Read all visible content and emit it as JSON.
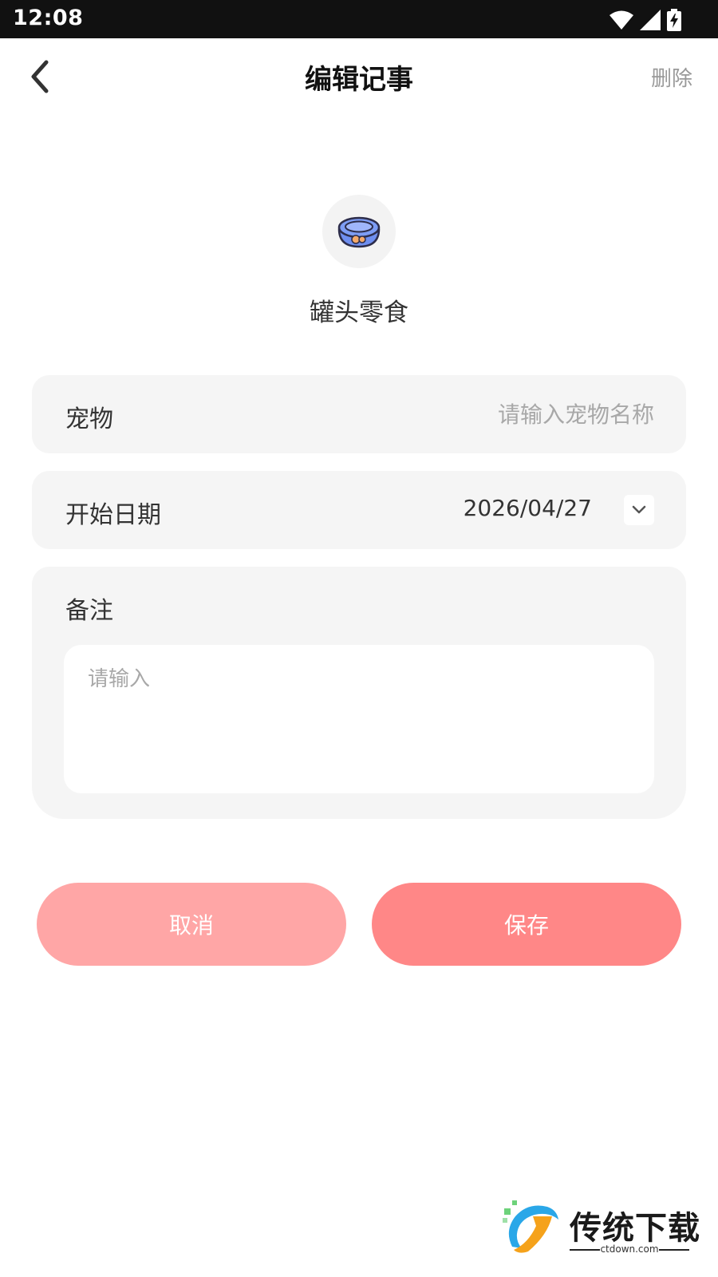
{
  "status_bar": {
    "time": "12:08",
    "icons": [
      "wifi-icon",
      "signal-icon",
      "battery-charging-icon"
    ]
  },
  "nav": {
    "title": "编辑记事",
    "delete_label": "删除",
    "back_icon": "chevron-left-icon"
  },
  "category": {
    "icon": "pet-food-bowl-icon",
    "name": "罐头零食"
  },
  "form": {
    "pet_label": "宠物",
    "pet_placeholder": "请输入宠物名称",
    "pet_value": "",
    "start_date_label": "开始日期",
    "start_date_value": "2026/04/27",
    "notes_label": "备注",
    "notes_placeholder": "请输入",
    "notes_value": ""
  },
  "buttons": {
    "cancel_label": "取消",
    "save_label": "保存"
  },
  "watermark": {
    "text": "传统下载",
    "subtext": "ctdown.com"
  },
  "colors": {
    "cancel_button": "#ffa6a6",
    "save_button": "#ff8787",
    "row_background": "#f5f5f5",
    "placeholder": "#a8a8a8"
  }
}
